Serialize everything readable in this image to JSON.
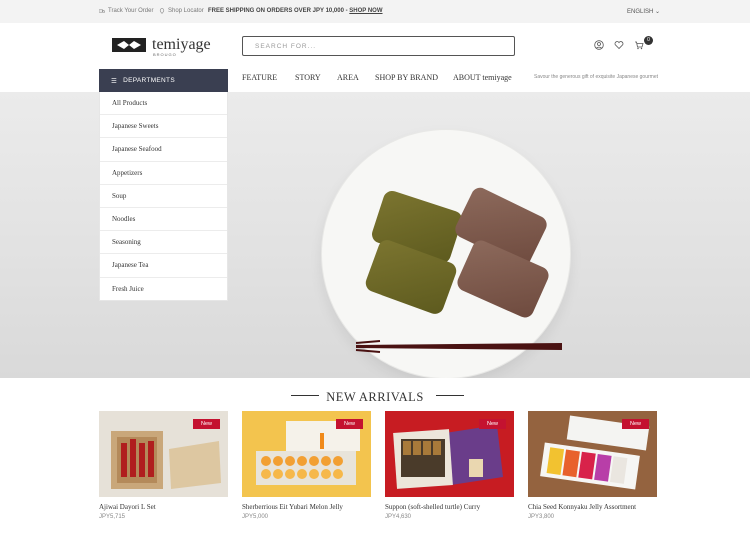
{
  "topbar": {
    "track": "Track Your Order",
    "locator": "Shop Locator",
    "shipping": "FREE SHIPPING ON ORDERS OVER JPY 10,000 - ",
    "shop_now": "SHOP NOW",
    "language": "ENGLISH"
  },
  "header": {
    "logo_word": "temiyage",
    "logo_sub": "BROUGO",
    "search_placeholder": "SEARCH FOR...",
    "cart_count": "0"
  },
  "nav": {
    "departments": "DEPARTMENTS",
    "items": [
      "FEATURE",
      "STORY",
      "AREA",
      "SHOP BY BRAND",
      "ABOUT temiyage"
    ],
    "tagline": "Savour the generous gift of exquisite Japanese gourmet"
  },
  "sidebar": {
    "items": [
      "All Products",
      "Japanese Sweets",
      "Japanese Seafood",
      "Appetizers",
      "Soup",
      "Noodles",
      "Seasoning",
      "Japanese Tea",
      "Fresh Juice"
    ]
  },
  "section": {
    "title": "NEW ARRIVALS"
  },
  "products": [
    {
      "badge": "New",
      "name": "Ajiwai Dayori L Set",
      "price": "JPY5,715"
    },
    {
      "badge": "New",
      "name": "Sherberrious Eit Yubari Melon Jelly",
      "price": "JPY5,000"
    },
    {
      "badge": "New",
      "name": "Suppon (soft-shelled turtle) Curry",
      "price": "JPY4,630"
    },
    {
      "badge": "New",
      "name": "Chia Seed Konnyaku Jelly Assortment",
      "price": "JPY3,800"
    }
  ],
  "colors": {
    "accent_navy": "#3a3f51",
    "badge_red": "#c41230"
  }
}
